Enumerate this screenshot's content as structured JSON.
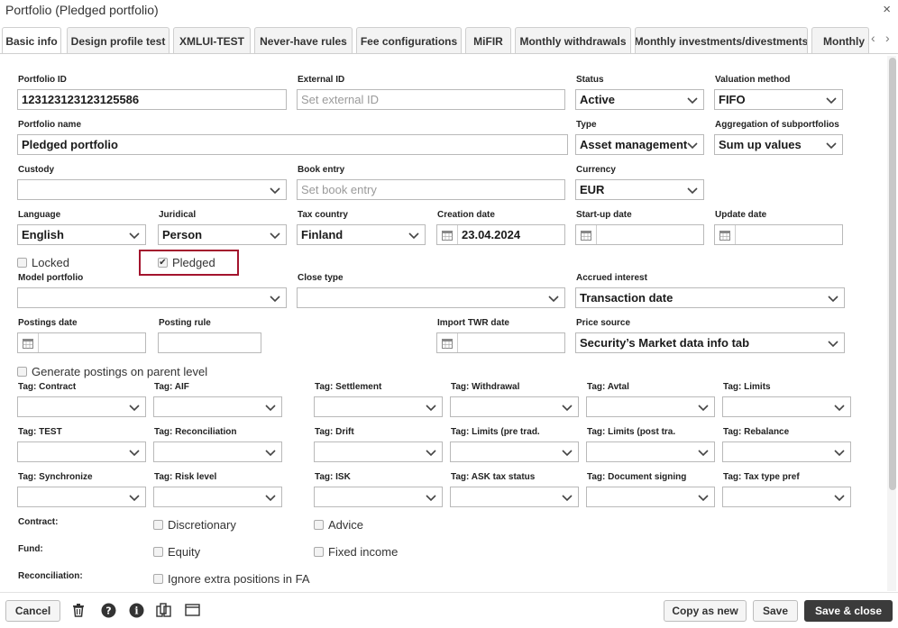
{
  "window": {
    "title": "Portfolio (Pledged portfolio)",
    "close_glyph": "×"
  },
  "tabs": [
    {
      "label": "Basic info",
      "active": true
    },
    {
      "label": "Design profile test"
    },
    {
      "label": "XMLUI-TEST"
    },
    {
      "label": "Never-have rules"
    },
    {
      "label": "Fee configurations"
    },
    {
      "label": "MiFIR"
    },
    {
      "label": "Monthly withdrawals"
    },
    {
      "label": "Monthly investments/divestments"
    },
    {
      "label": "Monthly s"
    }
  ],
  "tab_nav": {
    "prev": "‹",
    "next": "›"
  },
  "form": {
    "portfolio_id": {
      "label": "Portfolio ID",
      "value": "123123123123125586"
    },
    "external_id": {
      "label": "External ID",
      "placeholder": "Set external ID"
    },
    "status": {
      "label": "Status",
      "value": "Active"
    },
    "valuation_method": {
      "label": "Valuation method",
      "value": "FIFO"
    },
    "portfolio_name": {
      "label": "Portfolio name",
      "value": "Pledged portfolio"
    },
    "type": {
      "label": "Type",
      "value": "Asset management"
    },
    "aggregation": {
      "label": "Aggregation of subportfolios",
      "value": "Sum up values"
    },
    "custody": {
      "label": "Custody",
      "value": ""
    },
    "book_entry": {
      "label": "Book entry",
      "placeholder": "Set book entry"
    },
    "currency": {
      "label": "Currency",
      "value": "EUR"
    },
    "language": {
      "label": "Language",
      "value": "English"
    },
    "juridical": {
      "label": "Juridical",
      "value": "Person"
    },
    "tax_country": {
      "label": "Tax country",
      "value": "Finland"
    },
    "creation_date": {
      "label": "Creation date",
      "value": "23.04.2024"
    },
    "startup_date": {
      "label": "Start-up date",
      "value": ""
    },
    "update_date": {
      "label": "Update date",
      "value": ""
    },
    "locked": {
      "label": "Locked",
      "checked": false
    },
    "pledged": {
      "label": "Pledged",
      "checked": true
    },
    "model_portfolio": {
      "label": "Model portfolio",
      "value": ""
    },
    "close_type": {
      "label": "Close type",
      "value": ""
    },
    "accrued_interest": {
      "label": "Accrued interest",
      "value": "Transaction date"
    },
    "postings_date": {
      "label": "Postings date",
      "value": ""
    },
    "posting_rule": {
      "label": "Posting rule",
      "value": ""
    },
    "import_twr_date": {
      "label": "Import TWR date",
      "value": ""
    },
    "price_source": {
      "label": "Price source",
      "value": "Security’s Market data info tab"
    },
    "generate_postings": {
      "label": "Generate postings on parent level",
      "checked": false
    }
  },
  "tags": [
    "Tag: Contract",
    "Tag: AIF",
    "Tag: Settlement",
    "Tag: Withdrawal",
    "Tag: Avtal",
    "Tag: Limits",
    "Tag: TEST",
    "Tag: Reconciliation",
    "Tag: Drift",
    "Tag: Limits (pre trad.",
    "Tag: Limits (post tra.",
    "Tag: Rebalance",
    "Tag: Synchronize",
    "Tag: Risk level",
    "Tag: ISK",
    "Tag: ASK tax status",
    "Tag: Document signing",
    "Tag: Tax type pref"
  ],
  "groups": {
    "contract": {
      "label": "Contract:",
      "options": [
        "Discretionary",
        "Advice"
      ]
    },
    "fund": {
      "label": "Fund:",
      "options": [
        "Equity",
        "Fixed income"
      ]
    },
    "reconciliation": {
      "label": "Reconciliation:",
      "options": [
        "Ignore extra positions in FA"
      ]
    }
  },
  "footer": {
    "cancel": "Cancel",
    "copy_as_new": "Copy as new",
    "save": "Save",
    "save_close": "Save & close",
    "icons": [
      "trash-icon",
      "help-icon",
      "info-icon",
      "book-icon",
      "window-icon"
    ]
  },
  "colors": {
    "highlight": "#a3142d",
    "primary_button": "#3b3b3b"
  }
}
